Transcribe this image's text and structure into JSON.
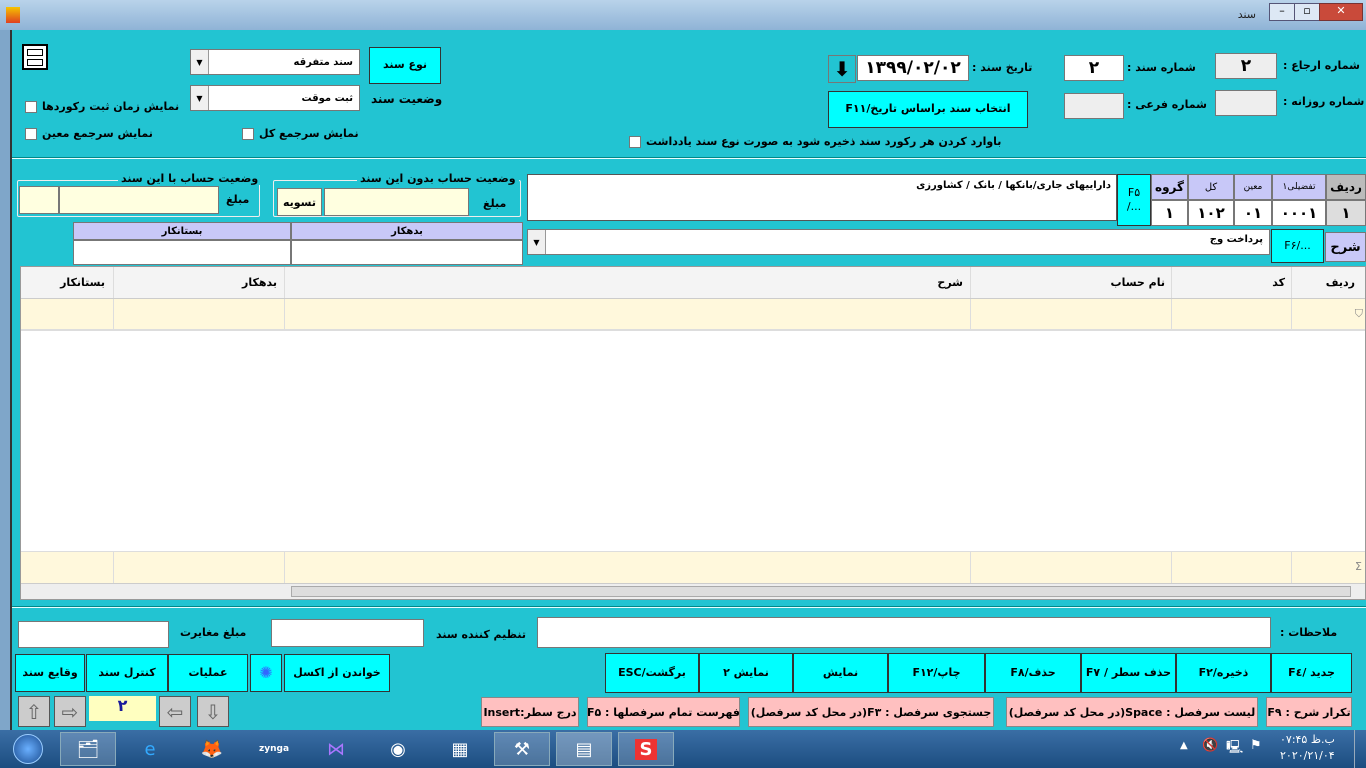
{
  "window": {
    "title": "سند"
  },
  "header": {
    "doc_type_button": "نوع سند",
    "doc_type_value": "سند متفرقه",
    "doc_status_label": "وضعیت سند",
    "doc_status_value": "ثبت موقت",
    "show_record_time": "نمایش زمان ثبت رکوردها",
    "show_total_sum": "نمایش سرجمع کل",
    "show_sub_sum": "نمایش سرجمع معین",
    "doc_date_label": "تاریخ سند :",
    "doc_date": "۱۳۹۹/۰۲/۰۲",
    "doc_number_label": "شماره سند :",
    "doc_number": "۲",
    "ref_number_label": "شماره ارجاع :",
    "ref_number": "۲",
    "daily_number_label": "شماره روزانه :",
    "daily_number": "",
    "sub_number_label": "شماره فرعی :",
    "sub_number": "",
    "select_by_date_button": "انتخاب سند  براساس تاریخ/F۱۱",
    "save_note_checkbox": "باوارد کردن هر رکورد  سند ذخیره شود به صورت نوع سند یادداشت"
  },
  "status": {
    "with_doc_title": "وضعیت حساب با این سند",
    "without_doc_title": "وضعیت حساب بدون این سند",
    "amount_label": "مبلغ",
    "settled": "تسویه",
    "debit": "بدهکار",
    "credit": "بستانکار"
  },
  "entry": {
    "headers": {
      "row": "ردیف",
      "detail1": "تفضیلی۱",
      "moein": "معین",
      "kol": "کل",
      "group": "گروه",
      "f5": "F۵",
      "f5b": ".../"
    },
    "values": {
      "row": "۱",
      "detail1": "۰۰۰۱",
      "moein": "۰۱",
      "kol": "۱۰۲",
      "group": "۱"
    },
    "account_path": "داراییهای جاری/بانکها / بانک / کشاورزی",
    "desc_label": "شرح",
    "desc_btn": ".../F۶",
    "desc_value": "پرداخت وج"
  },
  "grid": {
    "columns": [
      "ردیف",
      "کد",
      "نام حساب",
      "شرح",
      "بدهکار",
      "بستانکار"
    ],
    "rows": []
  },
  "footer": {
    "notes_label": "ملاحظات :",
    "creator_label": "تنظیم کننده سند",
    "diff_label": "مبلغ مغایرت",
    "buttons": [
      "جدید /F٤",
      "ذخیره/F۲",
      "حذف سطر / F۷",
      "حذف/F۸",
      "چاپ/F۱۲",
      "نمایش",
      "نمایش ۲",
      "برگشت/ESC"
    ],
    "left_buttons": [
      "خواندن از اکسل",
      "عملیات",
      "کنترل سند",
      "وقایع سند"
    ],
    "hints": [
      "تکرار شرح : F۹",
      "لیست سرفصل : Space(در محل کد سرفصل)",
      "جستجوی سرفصل : F۳(در محل کد سرفصل)",
      "فهرست تمام سرفصلها : F۵",
      "درج سطر:Insert"
    ],
    "page": "۲"
  },
  "taskbar": {
    "time": "ب.ظ ۰۷:۴۵",
    "date": "۲۰۲۰/۲۱/۰۴",
    "apps": [
      "file-explorer",
      "internet-explorer",
      "firefox",
      "zynga",
      "visual-studio",
      "chrome",
      "calculator",
      "tools",
      "app",
      "s-app"
    ]
  }
}
